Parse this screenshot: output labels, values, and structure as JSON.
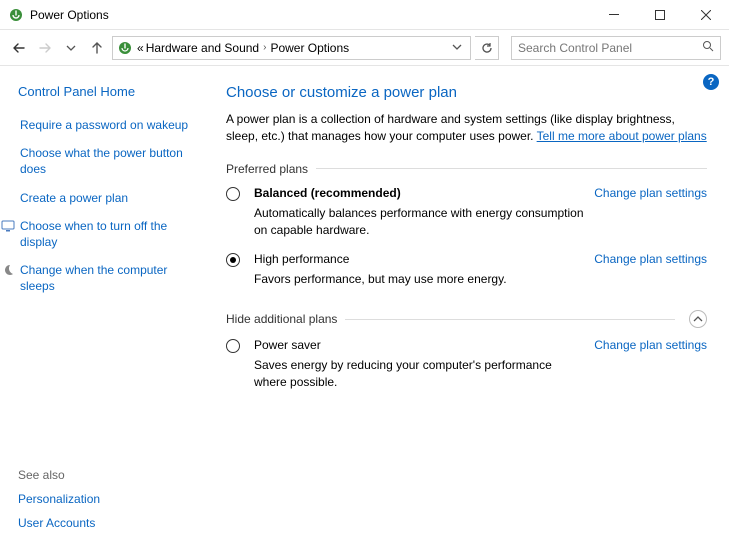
{
  "titlebar": {
    "title": "Power Options"
  },
  "toolbar": {
    "breadcrumb": {
      "prefix": "«",
      "items": [
        "Hardware and Sound",
        "Power Options"
      ]
    },
    "search_placeholder": "Search Control Panel"
  },
  "sidebar": {
    "home": "Control Panel Home",
    "links": [
      {
        "label": "Require a password on wakeup",
        "icon": null
      },
      {
        "label": "Choose what the power button does",
        "icon": null
      },
      {
        "label": "Create a power plan",
        "icon": null
      },
      {
        "label": "Choose when to turn off the display",
        "icon": "display"
      },
      {
        "label": "Change when the computer sleeps",
        "icon": "sleep"
      }
    ],
    "see_also_header": "See also",
    "see_also": [
      "Personalization",
      "User Accounts"
    ]
  },
  "main": {
    "heading": "Choose or customize a power plan",
    "intro_text": "A power plan is a collection of hardware and system settings (like display brightness, sleep, etc.) that manages how your computer uses power. ",
    "intro_link": "Tell me more about power plans",
    "preferred_header": "Preferred plans",
    "additional_header": "Hide additional plans",
    "change_link": "Change plan settings",
    "plans_preferred": [
      {
        "name": "Balanced (recommended)",
        "desc": "Automatically balances performance with energy consumption on capable hardware.",
        "selected": false,
        "bold": true
      },
      {
        "name": "High performance",
        "desc": "Favors performance, but may use more energy.",
        "selected": true,
        "bold": false
      }
    ],
    "plans_additional": [
      {
        "name": "Power saver",
        "desc": "Saves energy by reducing your computer's performance where possible.",
        "selected": false,
        "bold": false
      }
    ]
  }
}
